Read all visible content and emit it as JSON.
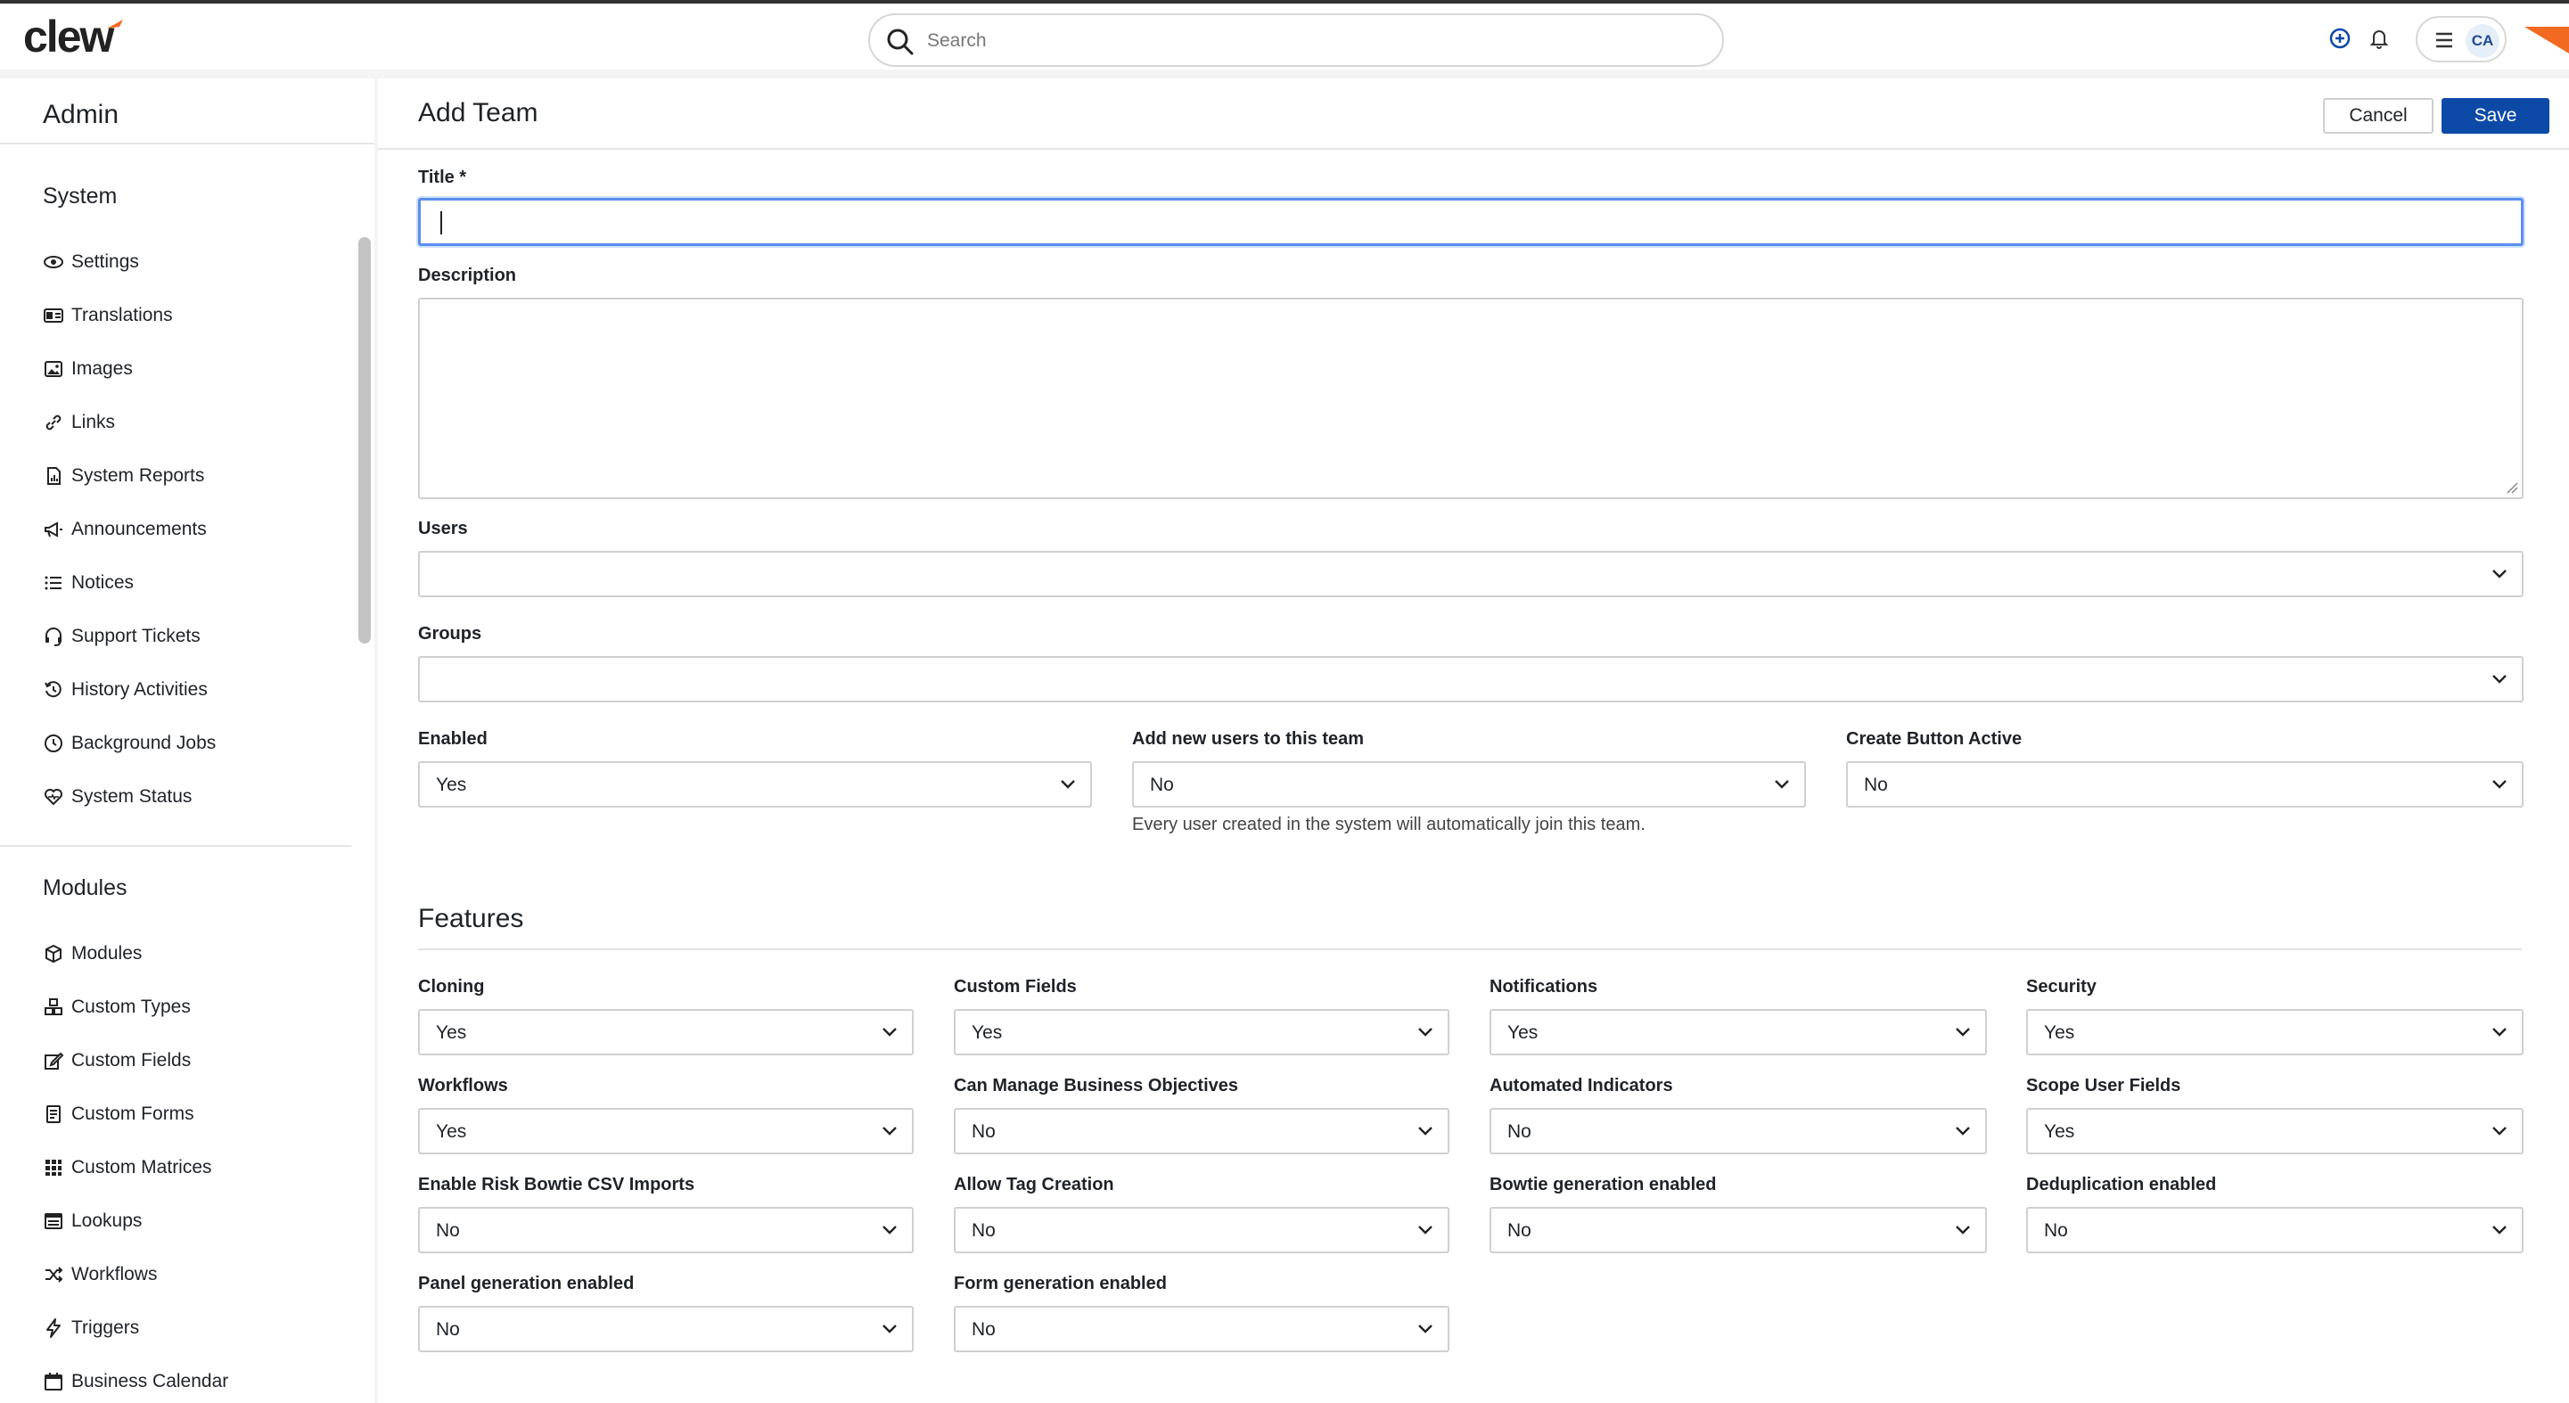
{
  "app": {
    "logo_text": "clew"
  },
  "search": {
    "placeholder": "Search"
  },
  "user": {
    "initials": "CA"
  },
  "sidebar": {
    "title": "Admin",
    "system_title": "System",
    "system_items": [
      {
        "label": "Settings",
        "icon": "eye-icon"
      },
      {
        "label": "Translations",
        "icon": "translation-icon"
      },
      {
        "label": "Images",
        "icon": "image-icon"
      },
      {
        "label": "Links",
        "icon": "link-icon"
      },
      {
        "label": "System Reports",
        "icon": "report-icon"
      },
      {
        "label": "Announcements",
        "icon": "megaphone-icon"
      },
      {
        "label": "Notices",
        "icon": "list-icon"
      },
      {
        "label": "Support Tickets",
        "icon": "headset-icon"
      },
      {
        "label": "History Activities",
        "icon": "history-icon"
      },
      {
        "label": "Background Jobs",
        "icon": "clock-icon"
      },
      {
        "label": "System Status",
        "icon": "heart-pulse-icon"
      }
    ],
    "modules_title": "Modules",
    "module_items": [
      {
        "label": "Modules",
        "icon": "cube-icon"
      },
      {
        "label": "Custom Types",
        "icon": "cubes-icon"
      },
      {
        "label": "Custom Fields",
        "icon": "edit-icon"
      },
      {
        "label": "Custom Forms",
        "icon": "form-icon"
      },
      {
        "label": "Custom Matrices",
        "icon": "grid-icon"
      },
      {
        "label": "Lookups",
        "icon": "lookup-icon"
      },
      {
        "label": "Workflows",
        "icon": "shuffle-icon"
      },
      {
        "label": "Triggers",
        "icon": "lightning-icon"
      },
      {
        "label": "Business Calendar",
        "icon": "calendar-icon"
      }
    ]
  },
  "page": {
    "title": "Add Team",
    "cancel_label": "Cancel",
    "save_label": "Save"
  },
  "form": {
    "title_label": "Title *",
    "title_value": "",
    "description_label": "Description",
    "users_label": "Users",
    "groups_label": "Groups",
    "enabled_label": "Enabled",
    "enabled_value": "Yes",
    "add_new_users_label": "Add new users to this team",
    "add_new_users_value": "No",
    "add_new_users_help": "Every user created in the system will automatically join this team.",
    "create_button_label": "Create Button Active",
    "create_button_value": "No"
  },
  "features": {
    "title": "Features",
    "items": [
      {
        "label": "Cloning",
        "value": "Yes"
      },
      {
        "label": "Custom Fields",
        "value": "Yes"
      },
      {
        "label": "Notifications",
        "value": "Yes"
      },
      {
        "label": "Security",
        "value": "Yes"
      },
      {
        "label": "Workflows",
        "value": "Yes"
      },
      {
        "label": "Can Manage Business Objectives",
        "value": "No"
      },
      {
        "label": "Automated Indicators",
        "value": "No"
      },
      {
        "label": "Scope User Fields",
        "value": "Yes"
      },
      {
        "label": "Enable Risk Bowtie CSV Imports",
        "value": "No"
      },
      {
        "label": "Allow Tag Creation",
        "value": "No"
      },
      {
        "label": "Bowtie generation enabled",
        "value": "No"
      },
      {
        "label": "Deduplication enabled",
        "value": "No"
      },
      {
        "label": "Panel generation enabled",
        "value": "No"
      },
      {
        "label": "Form generation enabled",
        "value": "No"
      }
    ]
  },
  "colors": {
    "primary": "#0d4aa8",
    "accent": "#f26a21",
    "focus": "#5b8ff0"
  }
}
